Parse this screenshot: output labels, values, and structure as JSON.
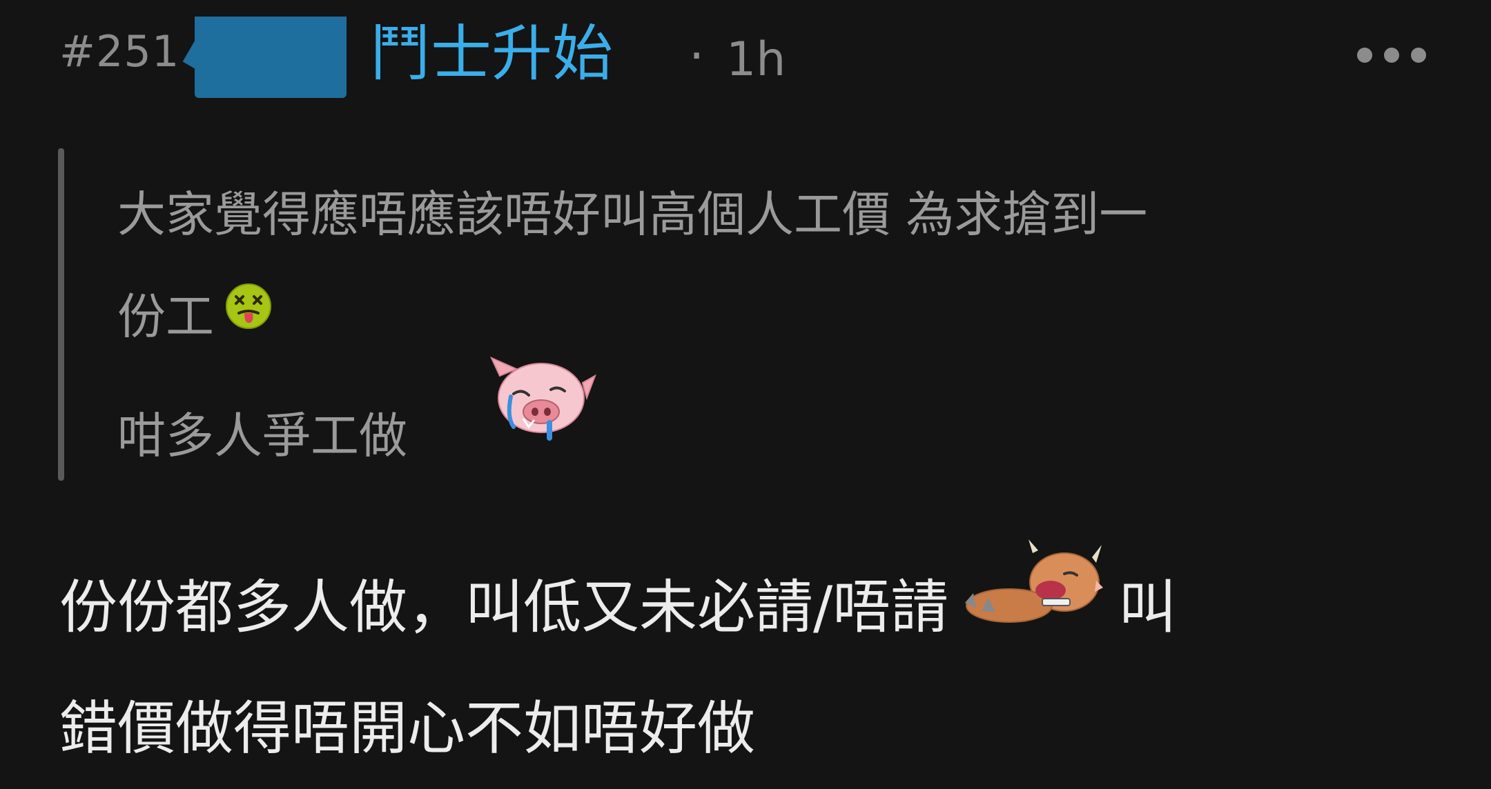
{
  "post": {
    "number": "#251",
    "username": "鬥士升始",
    "separator": "·",
    "timestamp": "1h"
  },
  "quote": {
    "line1": "大家覺得應唔應該唔好叫高個人工價 為求搶到一",
    "line2": "份工",
    "line3": "咁多人爭工做"
  },
  "body": {
    "line1_part1": "份份都多人做，叫低又未必請/唔請",
    "line1_part2": "叫",
    "line2": "錯價做得唔開心不如唔好做"
  },
  "icons": {
    "more": "more-horizontal-icon",
    "emoji_quote_1": "dizzy-sick-face-emoji",
    "emoji_quote_2": "crying-pig-emoji",
    "emoji_body": "collapsed-bull-emoji"
  },
  "colors": {
    "background": "#141414",
    "username": "#3aaeea",
    "meta": "#8c8c8c",
    "quote_text": "#9a9a9a",
    "body_text": "#ececec",
    "quote_bar": "#5a5a5a",
    "redaction": "#1e6f9e"
  }
}
